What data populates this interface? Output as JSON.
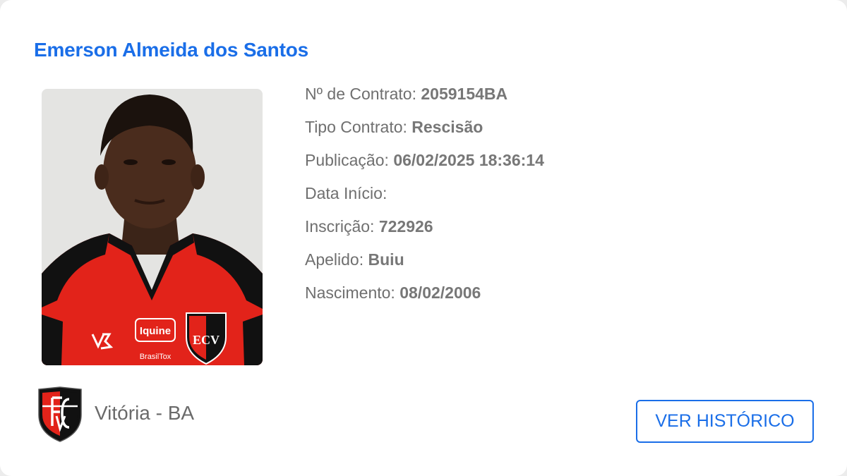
{
  "player": {
    "name": "Emerson Almeida dos Santos",
    "photo_alt": "Emerson Almeida dos Santos"
  },
  "details": [
    {
      "label": "Nº de Contrato:",
      "value": "2059154BA"
    },
    {
      "label": "Tipo Contrato:",
      "value": "Rescisão"
    },
    {
      "label": "Publicação:",
      "value": "06/02/2025 18:36:14"
    },
    {
      "label": "Data Início:",
      "value": ""
    },
    {
      "label": "Inscrição:",
      "value": "722926"
    },
    {
      "label": "Apelido:",
      "value": "Buiu"
    },
    {
      "label": "Nascimento:",
      "value": "08/02/2006"
    }
  ],
  "shirt_text": {
    "sponsor": "Iquine",
    "small_sponsor": "BrasilTox",
    "crest_letters": "ECV"
  },
  "club": {
    "name": "Vitória - BA",
    "crest_icon": "vitoria-crest-icon"
  },
  "actions": {
    "history_label": "VER HISTÓRICO"
  },
  "colors": {
    "accent": "#1a6ee8",
    "club_red": "#e2231a",
    "club_black": "#111111"
  }
}
